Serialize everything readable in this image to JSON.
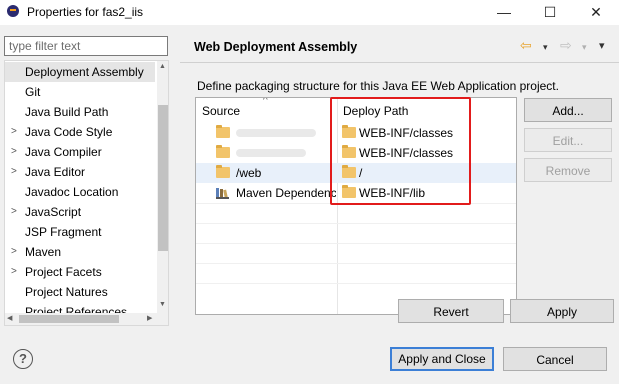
{
  "window": {
    "title": "Properties for fas2_iis",
    "minimize": "—",
    "maximize": "☐",
    "close": "✕"
  },
  "filter": {
    "placeholder": "type filter text"
  },
  "tree": {
    "items": [
      {
        "label": "Deployment Assembly",
        "arrow": "",
        "selected": true
      },
      {
        "label": "Git",
        "arrow": ""
      },
      {
        "label": "Java Build Path",
        "arrow": ""
      },
      {
        "label": "Java Code Style",
        "arrow": ">"
      },
      {
        "label": "Java Compiler",
        "arrow": ">"
      },
      {
        "label": "Java Editor",
        "arrow": ">"
      },
      {
        "label": "Javadoc Location",
        "arrow": ""
      },
      {
        "label": "JavaScript",
        "arrow": ">"
      },
      {
        "label": "JSP Fragment",
        "arrow": ""
      },
      {
        "label": "Maven",
        "arrow": ">"
      },
      {
        "label": "Project Facets",
        "arrow": ">"
      },
      {
        "label": "Project Natures",
        "arrow": ""
      },
      {
        "label": "Project References",
        "arrow": ""
      }
    ],
    "scroll_up": "▲",
    "scroll_down": "▼",
    "scroll_left": "◀",
    "scroll_right": "▶"
  },
  "header": {
    "title": "Web Deployment Assembly",
    "back_icon": "⇦",
    "forward_icon": "⇨",
    "dropdown": "▾",
    "menu": "▾"
  },
  "description": "Define packaging structure for this Java EE Web Application project.",
  "table": {
    "columns": {
      "source": "Source",
      "deploy": "Deploy Path"
    },
    "rows": [
      {
        "source": "",
        "source_icon": "folder",
        "deploy": "WEB-INF/classes",
        "blurred": true
      },
      {
        "source": "",
        "source_icon": "folder",
        "deploy": "WEB-INF/classes",
        "blurred": true
      },
      {
        "source": "/web",
        "source_icon": "folder",
        "deploy": "/",
        "highlight": true
      },
      {
        "source": "Maven Dependencies",
        "source_icon": "library",
        "deploy": "WEB-INF/lib"
      }
    ]
  },
  "side_buttons": {
    "add": "Add...",
    "edit": "Edit...",
    "remove": "Remove"
  },
  "bottom_buttons": {
    "revert": "Revert",
    "apply": "Apply"
  },
  "footer": {
    "help": "?",
    "apply_close": "Apply and Close",
    "cancel": "Cancel"
  },
  "colors": {
    "annotation": "#e21b1b",
    "default_button_border": "#3c7fd6",
    "folder": "#f2c46a"
  }
}
